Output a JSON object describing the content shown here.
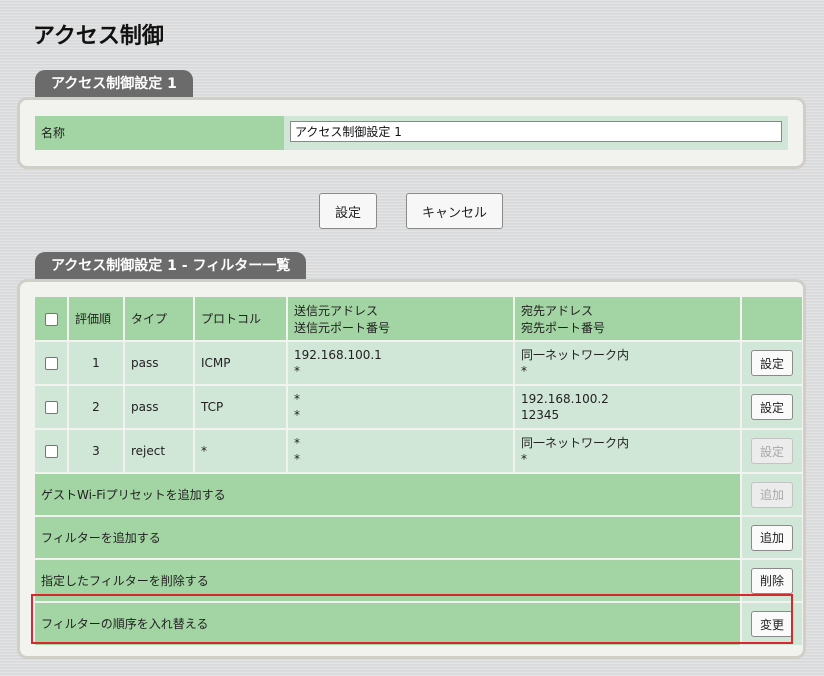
{
  "page": {
    "title": "アクセス制御"
  },
  "settings_section": {
    "tab_title": "アクセス制御設定 1",
    "name_label": "名称",
    "name_value": "アクセス制御設定 1"
  },
  "buttons": {
    "save": "設定",
    "cancel": "キャンセル"
  },
  "filter_section": {
    "tab_title": "アクセス制御設定 1 - フィルター一覧",
    "headers": {
      "order": "評価順",
      "type": "タイプ",
      "protocol": "プロトコル",
      "src_address": "送信元アドレス",
      "src_port": "送信元ポート番号",
      "dst_address": "宛先アドレス",
      "dst_port": "宛先ポート番号"
    },
    "rows": [
      {
        "checked": false,
        "order": "1",
        "type": "pass",
        "protocol": "ICMP",
        "src_address": "192.168.100.1",
        "src_port": "*",
        "dst_address": "同一ネットワーク内",
        "dst_port": "*",
        "button": "設定",
        "button_enabled": true
      },
      {
        "checked": false,
        "order": "2",
        "type": "pass",
        "protocol": "TCP",
        "src_address": "*",
        "src_port": "*",
        "dst_address": "192.168.100.2",
        "dst_port": "12345",
        "button": "設定",
        "button_enabled": true
      },
      {
        "checked": false,
        "order": "3",
        "type": "reject",
        "protocol": "*",
        "src_address": "*",
        "src_port": "*",
        "dst_address": "同一ネットワーク内",
        "dst_port": "*",
        "button": "設定",
        "button_enabled": false
      }
    ],
    "actions": [
      {
        "label": "ゲストWi-Fiプリセットを追加する",
        "button": "追加",
        "button_enabled": false
      },
      {
        "label": "フィルターを追加する",
        "button": "追加",
        "button_enabled": true
      },
      {
        "label": "指定したフィルターを削除する",
        "button": "削除",
        "button_enabled": true
      },
      {
        "label": "フィルターの順序を入れ替える",
        "button": "変更",
        "button_enabled": true
      }
    ]
  },
  "colors": {
    "header_green": "#a3d4a3",
    "cell_green": "#d0e6d6",
    "tab_gray": "#6b6b6b",
    "highlight_red": "#d9272e"
  }
}
